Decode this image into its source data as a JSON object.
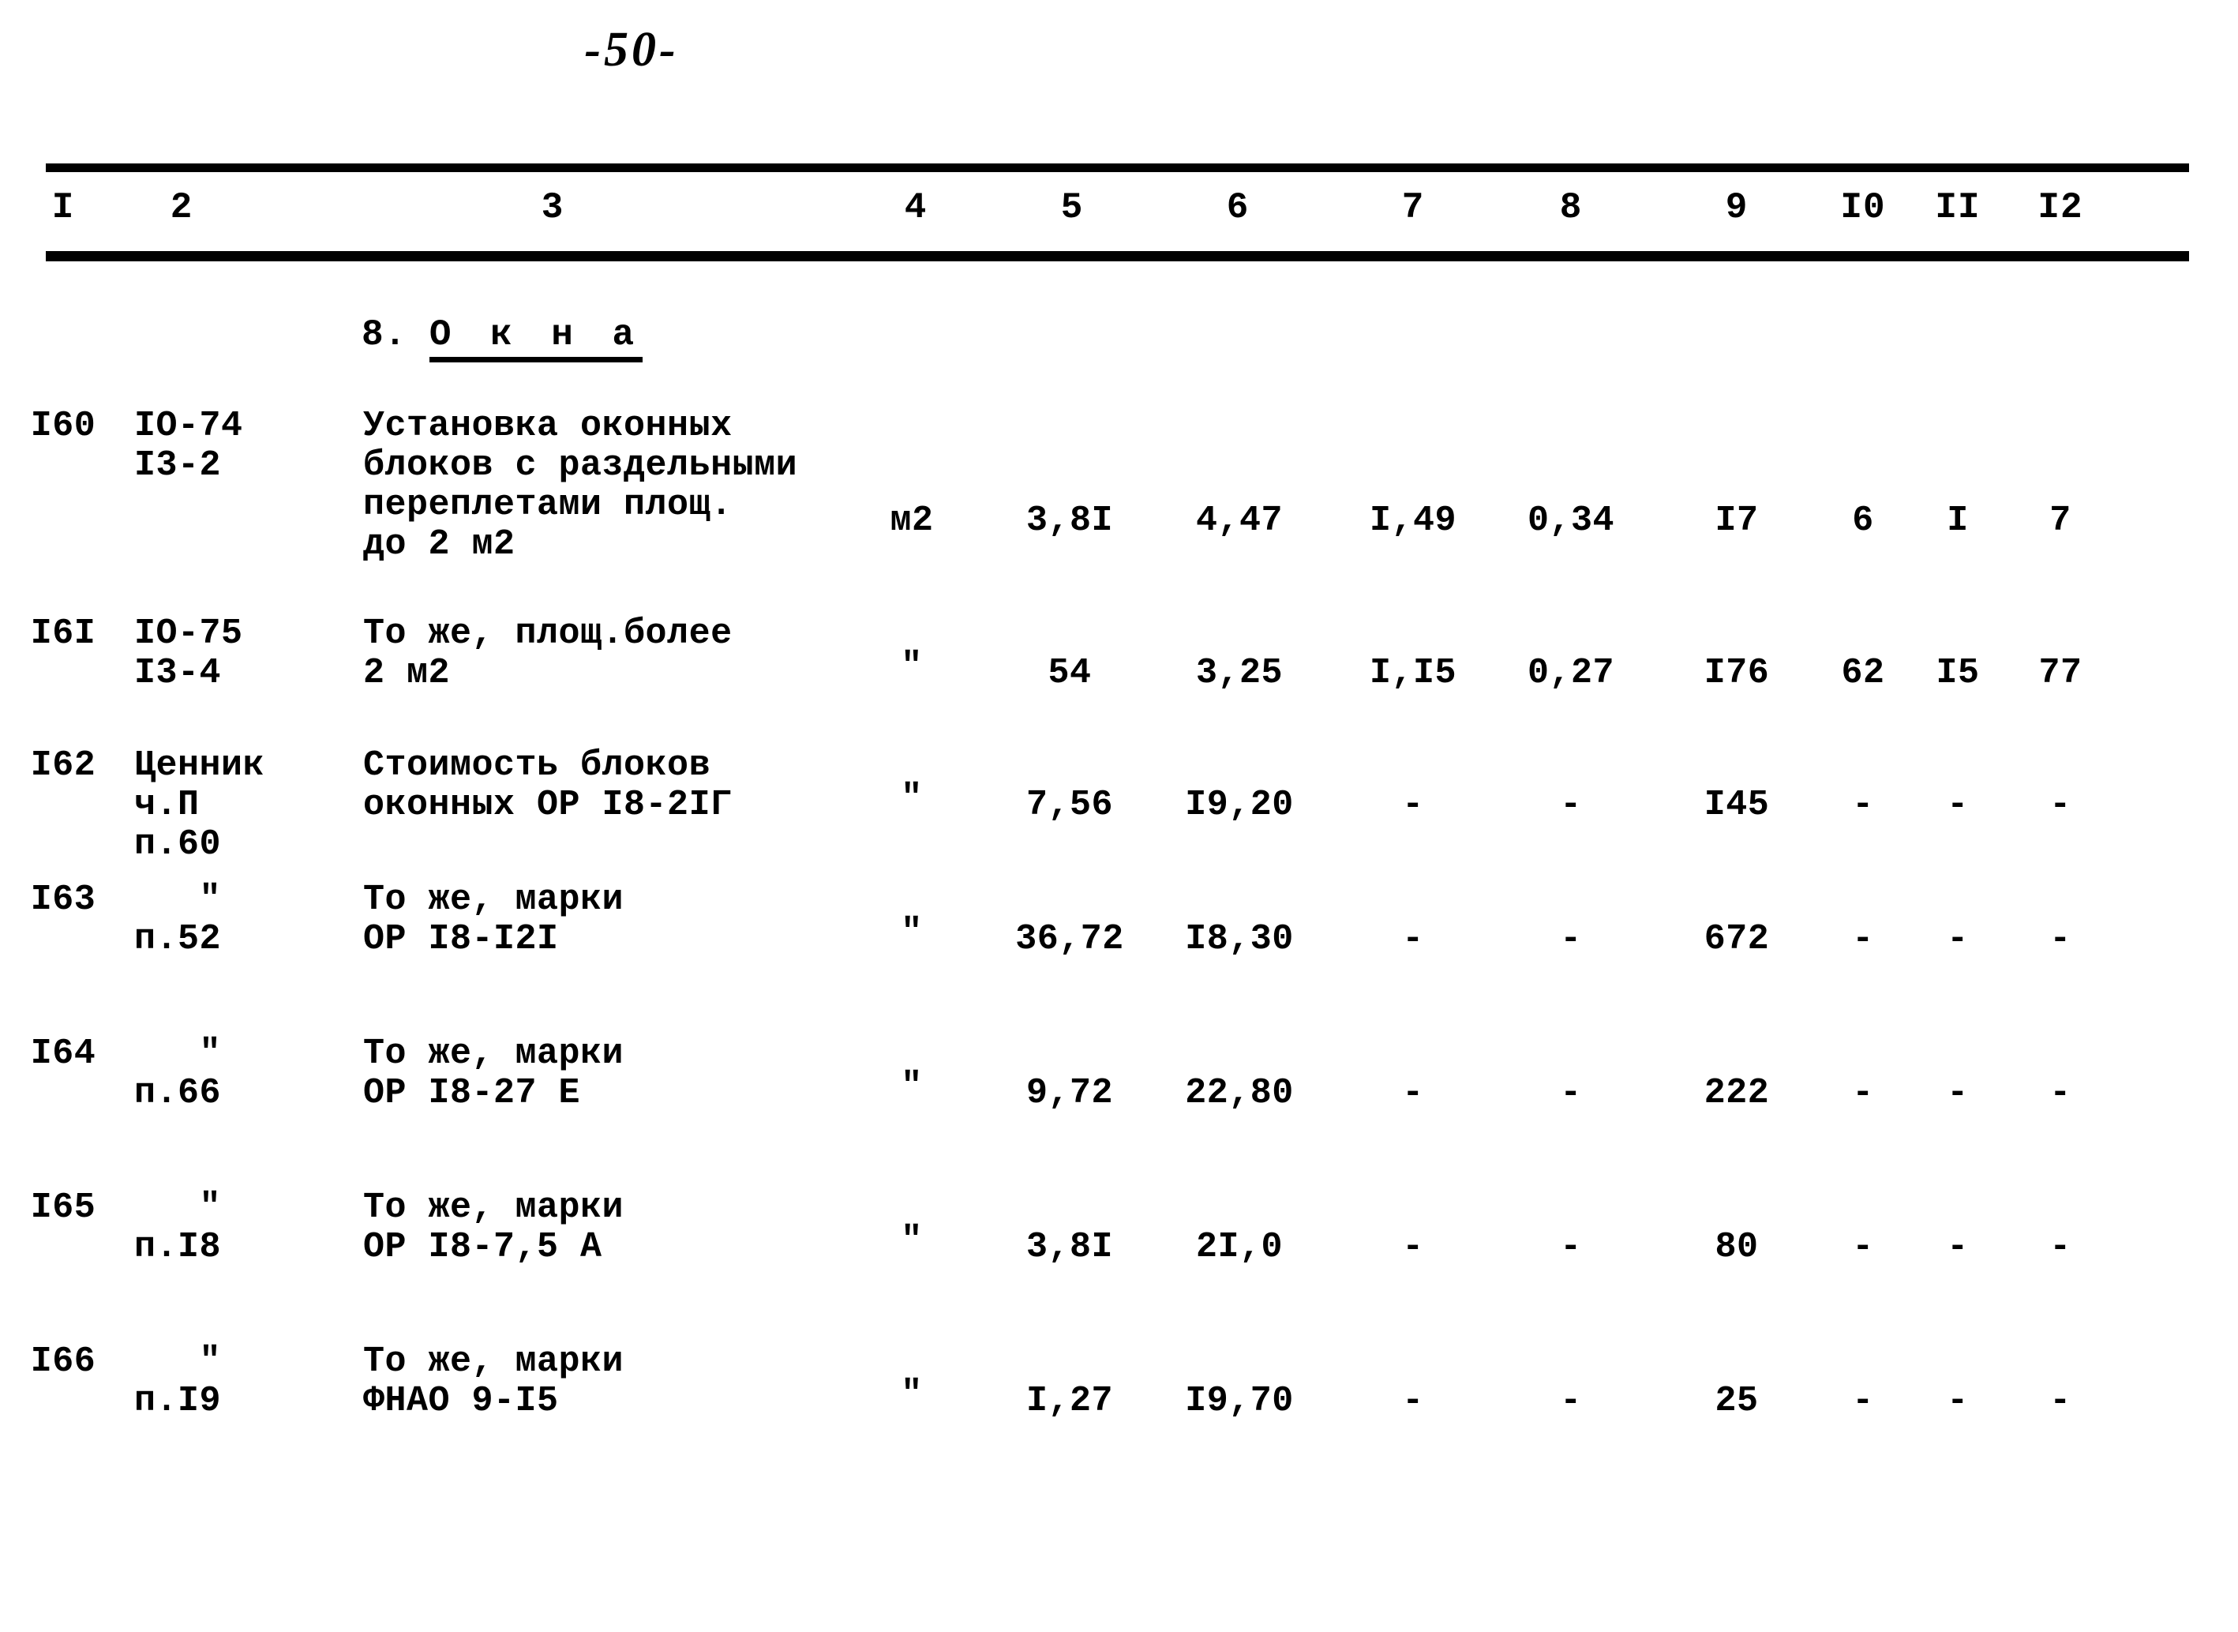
{
  "page": {
    "number_label": "-50-"
  },
  "table": {
    "column_headers": [
      "I",
      "2",
      "3",
      "4",
      "5",
      "6",
      "7",
      "8",
      "9",
      "I0",
      "II",
      "I2"
    ],
    "section_heading": {
      "number": "8.",
      "title": "О к н а"
    },
    "rows": [
      {
        "c1": "I60",
        "c2": "IO-74\nI3-2",
        "c3": "Установка оконных\nблоков с раздельными\nпереплетами площ.\nдо 2 м2",
        "c4": "м2",
        "c5": "3,8I",
        "c6": "4,47",
        "c7": "I,49",
        "c8": "0,34",
        "c9": "I7",
        "c10": "6",
        "c11": "I",
        "c12": "7"
      },
      {
        "c1": "I6I",
        "c2": "IO-75\nI3-4",
        "c3": "То же, площ.более\n2 м2",
        "c4": "\"",
        "c5": "54",
        "c6": "3,25",
        "c7": "I,I5",
        "c8": "0,27",
        "c9": "I76",
        "c10": "62",
        "c11": "I5",
        "c12": "77"
      },
      {
        "c1": "I62",
        "c2": "Ценник\nч.П\nп.60",
        "c3": "Стоимость блоков\nоконных ОР I8-2IГ",
        "c4": "\"",
        "c5": "7,56",
        "c6": "I9,20",
        "c7": "-",
        "c8": "-",
        "c9": "I45",
        "c10": "-",
        "c11": "-",
        "c12": "-"
      },
      {
        "c1": "I63",
        "c2": "   \"\nп.52",
        "c3": "То же, марки\nОР I8-I2I",
        "c4": "\"",
        "c5": "36,72",
        "c6": "I8,30",
        "c7": "-",
        "c8": "-",
        "c9": "672",
        "c10": "-",
        "c11": "-",
        "c12": "-"
      },
      {
        "c1": "I64",
        "c2": "   \"\nп.66",
        "c3": "То же, марки\nОР I8-27 Е",
        "c4": "\"",
        "c5": "9,72",
        "c6": "22,80",
        "c7": "-",
        "c8": "-",
        "c9": "222",
        "c10": "-",
        "c11": "-",
        "c12": "-"
      },
      {
        "c1": "I65",
        "c2": "   \"\nп.I8",
        "c3": "То же, марки\nОР I8-7,5 А",
        "c4": "\"",
        "c5": "3,8I",
        "c6": "2I,0",
        "c7": "-",
        "c8": "-",
        "c9": "80",
        "c10": "-",
        "c11": "-",
        "c12": "-"
      },
      {
        "c1": "I66",
        "c2": "   \"\nп.I9",
        "c3": "То же, марки\nФНАО 9-I5",
        "c4": "\"",
        "c5": "I,27",
        "c6": "I9,70",
        "c7": "-",
        "c8": "-",
        "c9": "25",
        "c10": "-",
        "c11": "-",
        "c12": "-"
      }
    ]
  }
}
